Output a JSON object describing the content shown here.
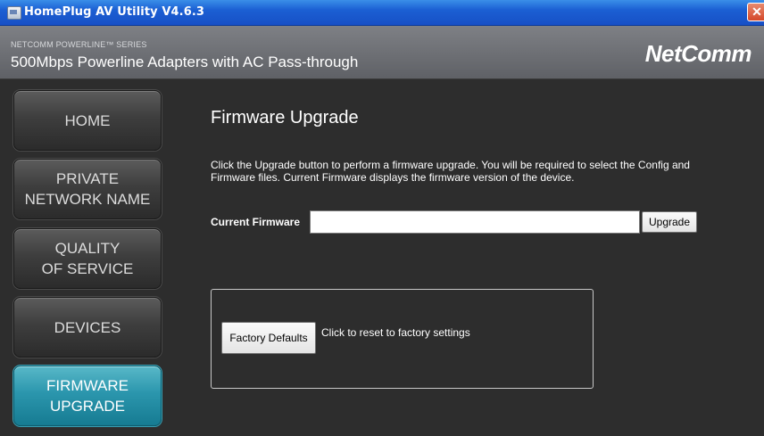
{
  "window": {
    "title": "HomePlug AV Utility V4.6.3",
    "close_glyph": "✕"
  },
  "header": {
    "series": "NETCOMM POWERLINE™ SERIES",
    "product": "500Mbps Powerline Adapters with AC Pass-through",
    "logo": "NetComm"
  },
  "sidebar": {
    "items": [
      {
        "line1": "HOME",
        "line2": "",
        "active": false
      },
      {
        "line1": "PRIVATE",
        "line2": "NETWORK NAME",
        "active": false
      },
      {
        "line1": "QUALITY",
        "line2": "OF SERVICE",
        "active": false
      },
      {
        "line1": "DEVICES",
        "line2": "",
        "active": false
      },
      {
        "line1": "FIRMWARE",
        "line2": "UPGRADE",
        "active": true
      }
    ]
  },
  "main": {
    "title": "Firmware Upgrade",
    "description": "Click the Upgrade button to perform a firmware upgrade. You will be required to select the Config and Firmware files. Current Firmware displays the firmware version of the device.",
    "current_firmware_label": "Current Firmware",
    "current_firmware_value": "",
    "upgrade_label": "Upgrade",
    "factory_defaults_label": "Factory Defaults",
    "factory_defaults_text": "Click to reset to factory settings"
  },
  "colors": {
    "active_nav": "#2b96ad",
    "titlebar": "#1b5fd3",
    "background": "#2d2d2d"
  }
}
